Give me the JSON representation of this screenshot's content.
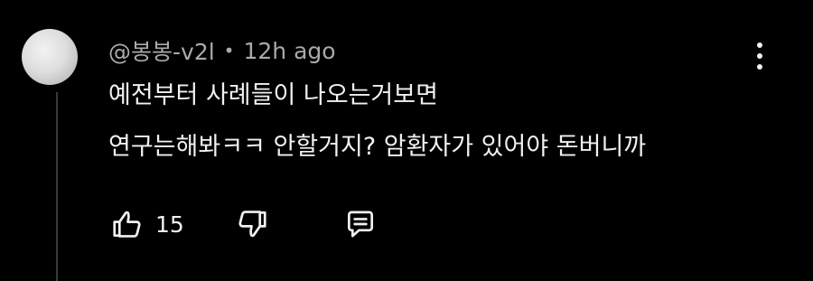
{
  "comment": {
    "author": "@봉봉-v2l",
    "separator": "•",
    "time": "12h ago",
    "text_lines": [
      "예전부터 사례들이 나오는거보면",
      "연구는해봐ㅋㅋ 안할거지? 암환자가 있어야 돈버니까"
    ],
    "like_count": "15"
  },
  "icons": {
    "menu": "more-vertical-icon",
    "like": "thumbs-up-icon",
    "dislike": "thumbs-down-icon",
    "reply": "reply-icon"
  },
  "colors": {
    "background": "#000000",
    "text": "#f1f1f1",
    "meta_text": "#aaaaaa",
    "thread_line": "#3a3a3a"
  }
}
